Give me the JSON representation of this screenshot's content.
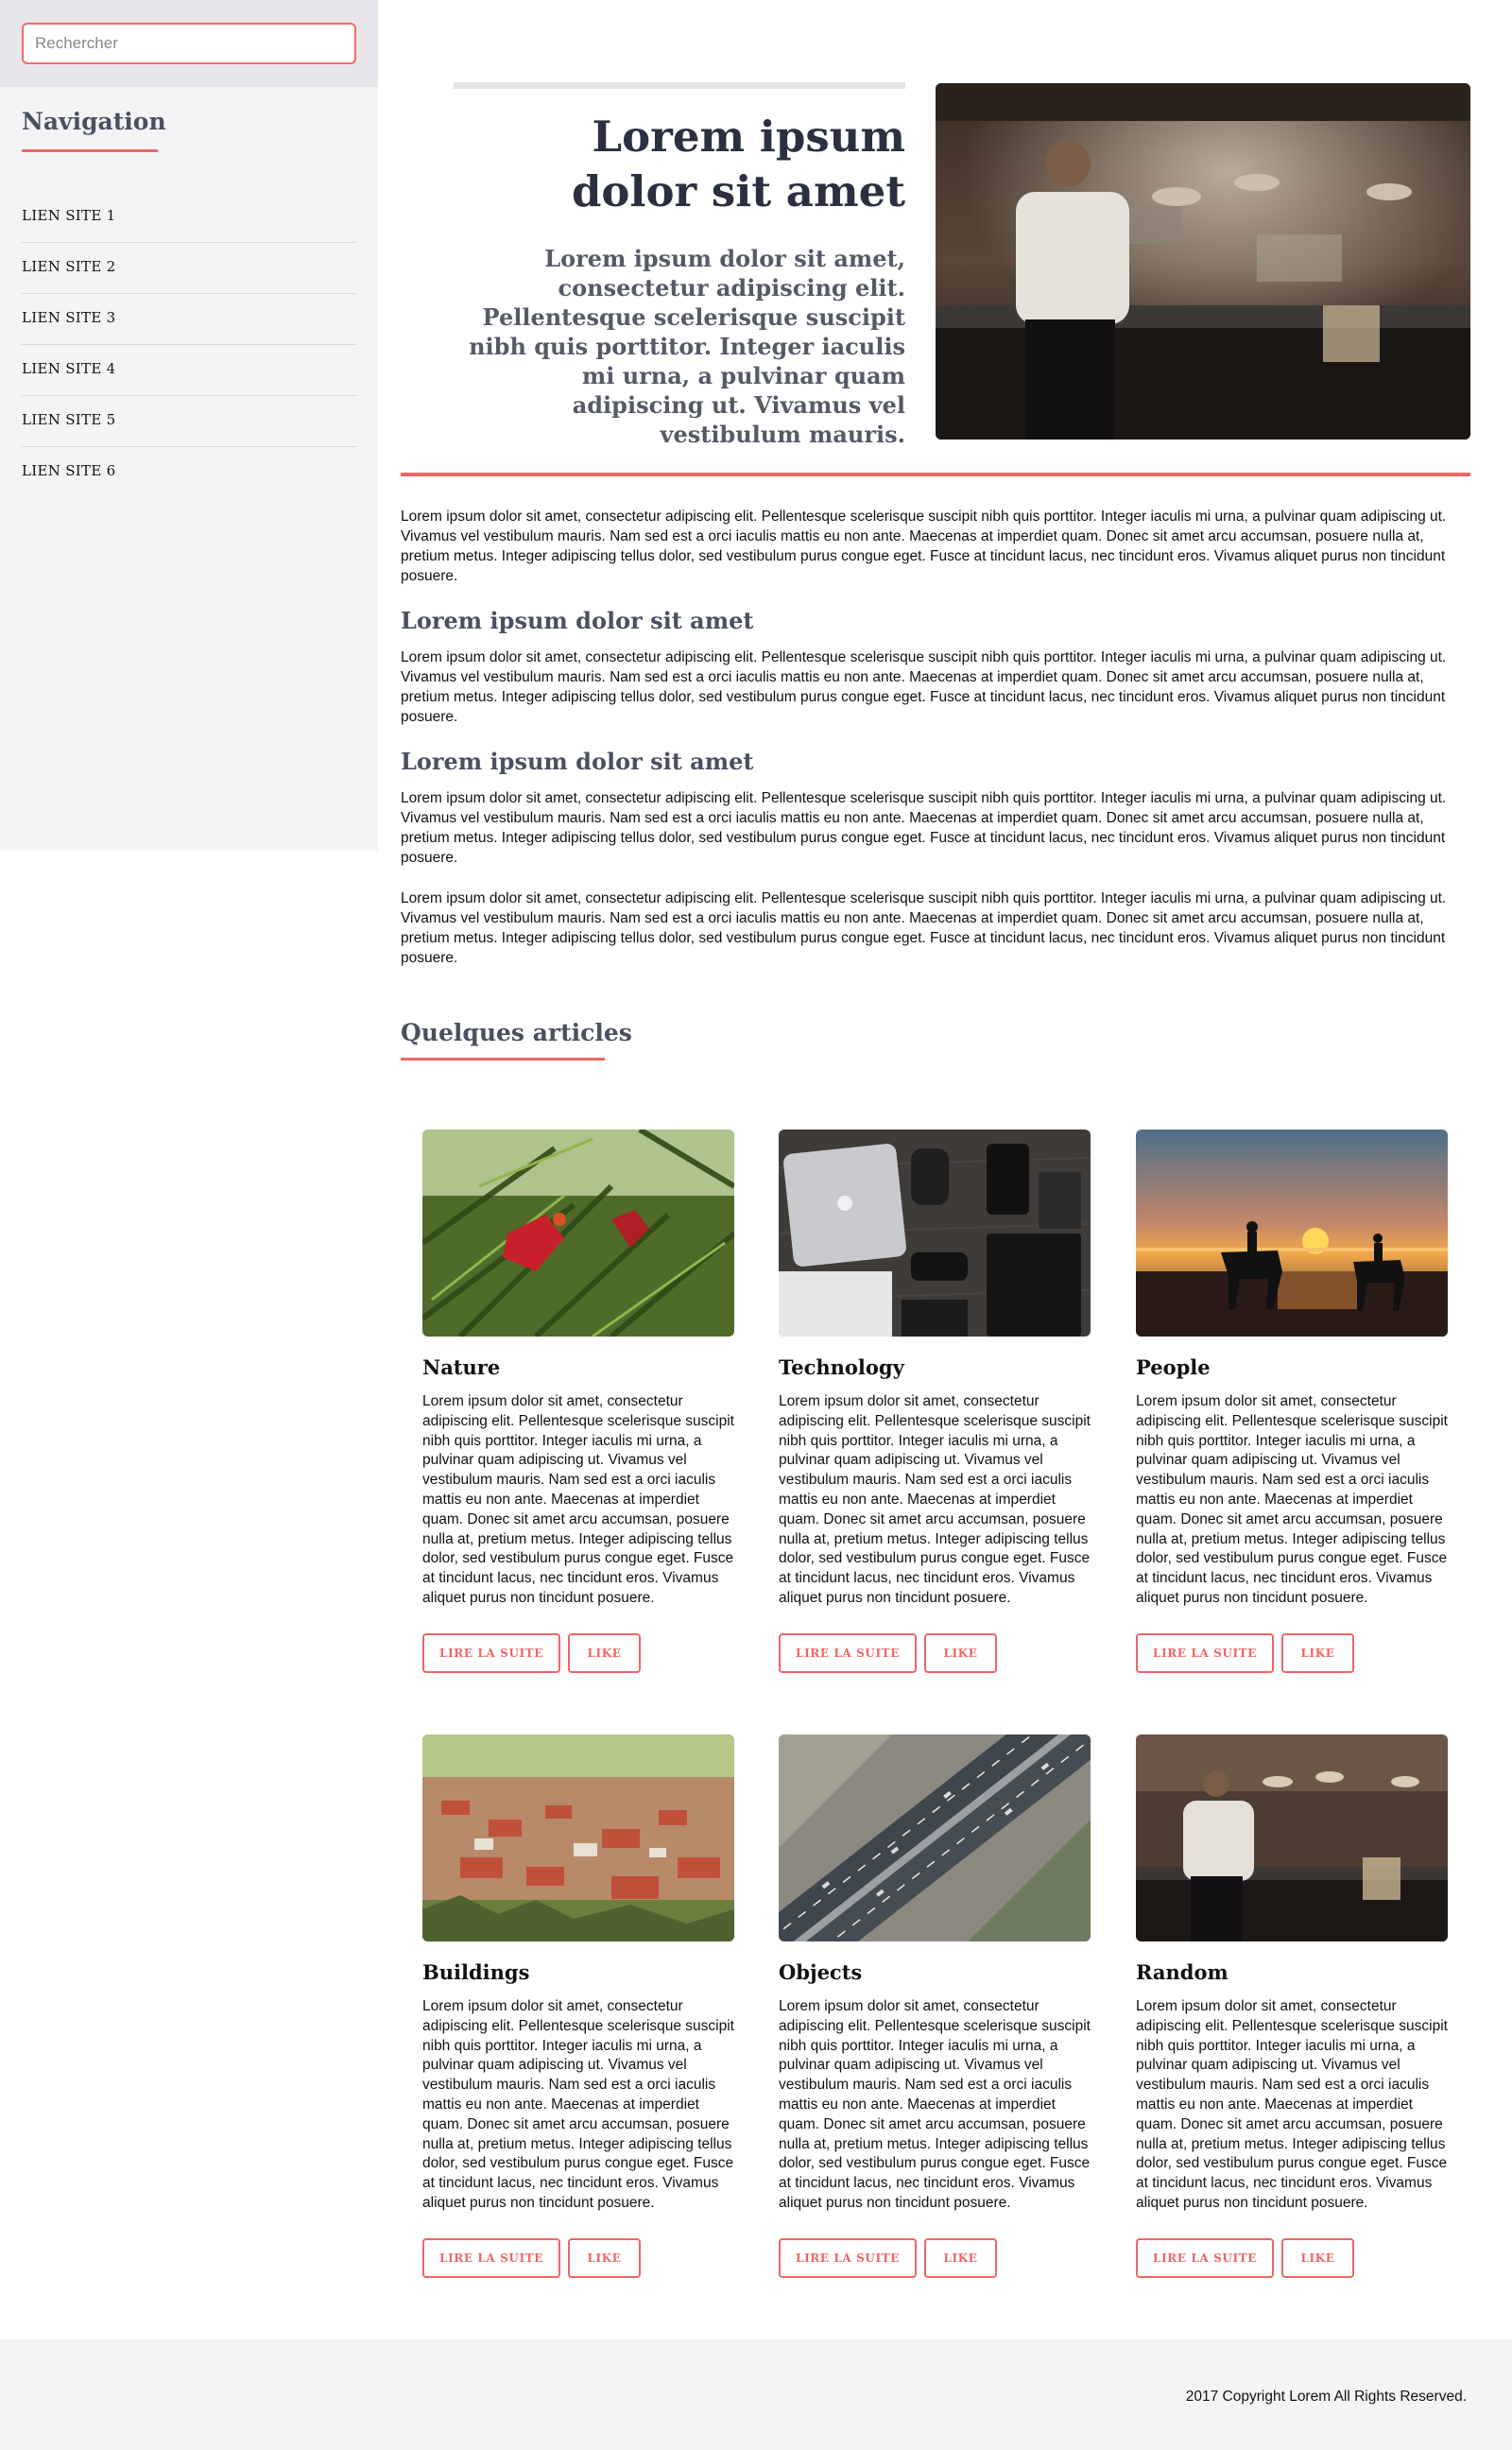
{
  "sidebar": {
    "search_placeholder": "Rechercher",
    "title": "Navigation",
    "links": [
      "LIEN SITE 1",
      "LIEN SITE 2",
      "LIEN SITE 3",
      "LIEN SITE 4",
      "LIEN SITE 5",
      "LIEN SITE 6"
    ]
  },
  "hero": {
    "title": "Lorem ipsum dolor sit amet",
    "subtitle": "Lorem ipsum dolor sit amet, consectetur adipiscing elit. Pellentesque scelerisque suscipit nibh quis porttitor. Integer iaculis mi urna, a pulvinar quam adipiscing ut. Vivamus vel vestibulum mauris.",
    "image": "chef-in-kitchen-photo"
  },
  "article": {
    "paragraph_1": "Lorem ipsum dolor sit amet, consectetur adipiscing elit. Pellentesque scelerisque suscipit nibh quis porttitor. Integer iaculis mi urna, a pulvinar quam adipiscing ut. Vivamus vel vestibulum mauris. Nam sed est a orci iaculis mattis eu non ante. Maecenas at imperdiet quam. Donec sit amet arcu accumsan, posuere nulla at, pretium metus. Integer adipiscing tellus dolor, sed vestibulum purus congue eget. Fusce at tincidunt lacus, nec tincidunt eros. Vivamus aliquet purus non tincidunt posuere.",
    "heading_1": "Lorem ipsum dolor sit amet",
    "paragraph_2": "Lorem ipsum dolor sit amet, consectetur adipiscing elit. Pellentesque scelerisque suscipit nibh quis porttitor. Integer iaculis mi urna, a pulvinar quam adipiscing ut. Vivamus vel vestibulum mauris. Nam sed est a orci iaculis mattis eu non ante. Maecenas at imperdiet quam. Donec sit amet arcu accumsan, posuere nulla at, pretium metus. Integer adipiscing tellus dolor, sed vestibulum purus congue eget. Fusce at tincidunt lacus, nec tincidunt eros. Vivamus aliquet purus non tincidunt posuere.",
    "heading_2": "Lorem ipsum dolor sit amet",
    "paragraph_3": "Lorem ipsum dolor sit amet, consectetur adipiscing elit. Pellentesque scelerisque suscipit nibh quis porttitor. Integer iaculis mi urna, a pulvinar quam adipiscing ut. Vivamus vel vestibulum mauris. Nam sed est a orci iaculis mattis eu non ante. Maecenas at imperdiet quam. Donec sit amet arcu accumsan, posuere nulla at, pretium metus. Integer adipiscing tellus dolor, sed vestibulum purus congue eget. Fusce at tincidunt lacus, nec tincidunt eros. Vivamus aliquet purus non tincidunt posuere.",
    "paragraph_4": "Lorem ipsum dolor sit amet, consectetur adipiscing elit. Pellentesque scelerisque suscipit nibh quis porttitor. Integer iaculis mi urna, a pulvinar quam adipiscing ut. Vivamus vel vestibulum mauris. Nam sed est a orci iaculis mattis eu non ante. Maecenas at imperdiet quam. Donec sit amet arcu accumsan, posuere nulla at, pretium metus. Integer adipiscing tellus dolor, sed vestibulum purus congue eget. Fusce at tincidunt lacus, nec tincidunt eros. Vivamus aliquet purus non tincidunt posuere."
  },
  "articles": {
    "section_title": "Quelques articles",
    "read_more_label": "LIRE LA SUITE",
    "like_label": "LIKE",
    "cards": [
      {
        "title": "Nature",
        "image": "parrot-in-palm-photo",
        "text": "Lorem ipsum dolor sit amet, consectetur adipiscing elit. Pellentesque scelerisque suscipit nibh quis porttitor. Integer iaculis mi urna, a pulvinar quam adipiscing ut. Vivamus vel vestibulum mauris. Nam sed est a orci iaculis mattis eu non ante. Maecenas at imperdiet quam. Donec sit amet arcu accumsan, posuere nulla at, pretium metus. Integer adipiscing tellus dolor, sed vestibulum purus congue eget. Fusce at tincidunt lacus, nec tincidunt eros. Vivamus aliquet purus non tincidunt posuere."
      },
      {
        "title": "Technology",
        "image": "laptop-desk-photo",
        "text": "Lorem ipsum dolor sit amet, consectetur adipiscing elit. Pellentesque scelerisque suscipit nibh quis porttitor. Integer iaculis mi urna, a pulvinar quam adipiscing ut. Vivamus vel vestibulum mauris. Nam sed est a orci iaculis mattis eu non ante. Maecenas at imperdiet quam. Donec sit amet arcu accumsan, posuere nulla at, pretium metus. Integer adipiscing tellus dolor, sed vestibulum purus congue eget. Fusce at tincidunt lacus, nec tincidunt eros. Vivamus aliquet purus non tincidunt posuere."
      },
      {
        "title": "People",
        "image": "horses-beach-sunset-photo",
        "text": "Lorem ipsum dolor sit amet, consectetur adipiscing elit. Pellentesque scelerisque suscipit nibh quis porttitor. Integer iaculis mi urna, a pulvinar quam adipiscing ut. Vivamus vel vestibulum mauris. Nam sed est a orci iaculis mattis eu non ante. Maecenas at imperdiet quam. Donec sit amet arcu accumsan, posuere nulla at, pretium metus. Integer adipiscing tellus dolor, sed vestibulum purus congue eget. Fusce at tincidunt lacus, nec tincidunt eros. Vivamus aliquet purus non tincidunt posuere."
      },
      {
        "title": "Buildings",
        "image": "town-aerial-photo",
        "text": "Lorem ipsum dolor sit amet, consectetur adipiscing elit. Pellentesque scelerisque suscipit nibh quis porttitor. Integer iaculis mi urna, a pulvinar quam adipiscing ut. Vivamus vel vestibulum mauris. Nam sed est a orci iaculis mattis eu non ante. Maecenas at imperdiet quam. Donec sit amet arcu accumsan, posuere nulla at, pretium metus. Integer adipiscing tellus dolor, sed vestibulum purus congue eget. Fusce at tincidunt lacus, nec tincidunt eros. Vivamus aliquet purus non tincidunt posuere."
      },
      {
        "title": "Objects",
        "image": "highway-aerial-photo",
        "text": "Lorem ipsum dolor sit amet, consectetur adipiscing elit. Pellentesque scelerisque suscipit nibh quis porttitor. Integer iaculis mi urna, a pulvinar quam adipiscing ut. Vivamus vel vestibulum mauris. Nam sed est a orci iaculis mattis eu non ante. Maecenas at imperdiet quam. Donec sit amet arcu accumsan, posuere nulla at, pretium metus. Integer adipiscing tellus dolor, sed vestibulum purus congue eget. Fusce at tincidunt lacus, nec tincidunt eros. Vivamus aliquet purus non tincidunt posuere."
      },
      {
        "title": "Random",
        "image": "chef-in-kitchen-photo",
        "text": "Lorem ipsum dolor sit amet, consectetur adipiscing elit. Pellentesque scelerisque suscipit nibh quis porttitor. Integer iaculis mi urna, a pulvinar quam adipiscing ut. Vivamus vel vestibulum mauris. Nam sed est a orci iaculis mattis eu non ante. Maecenas at imperdiet quam. Donec sit amet arcu accumsan, posuere nulla at, pretium metus. Integer adipiscing tellus dolor, sed vestibulum purus congue eget. Fusce at tincidunt lacus, nec tincidunt eros. Vivamus aliquet purus non tincidunt posuere."
      }
    ]
  },
  "footer": {
    "copyright": "2017 Copyright Lorem All Rights Reserved."
  },
  "colors": {
    "accent": "#ee6666",
    "heading": "#4a5060",
    "sidebar_bg": "#f4f4f6",
    "footer_bg": "#f4f4f6"
  }
}
